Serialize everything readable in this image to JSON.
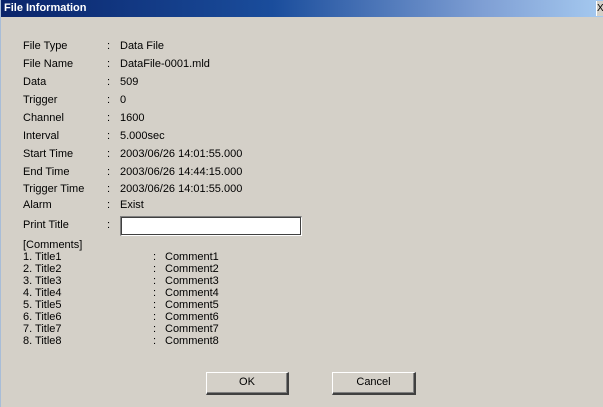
{
  "window": {
    "title": "File Information",
    "close_glyph": "X"
  },
  "fields": [
    {
      "label": "File Type",
      "colon": ":",
      "value": "Data File"
    },
    {
      "label": "File Name",
      "colon": ":",
      "value": "DataFile-0001.mld"
    },
    {
      "label": "Data",
      "colon": ":",
      "value": "509"
    },
    {
      "label": "Trigger",
      "colon": ":",
      "value": "0"
    },
    {
      "label": "Channel",
      "colon": ":",
      "value": "1600"
    },
    {
      "label": "Interval",
      "colon": ":",
      "value": "5.000sec"
    },
    {
      "label": "Start Time",
      "colon": ":",
      "value": "2003/06/26 14:01:55.000"
    },
    {
      "label": "End Time",
      "colon": ":",
      "value": "2003/06/26 14:44:15.000"
    },
    {
      "label": "Trigger Time",
      "colon": ":",
      "value": "2003/06/26 14:01:55.000"
    },
    {
      "label": "Alarm",
      "colon": ":",
      "value": "Exist"
    }
  ],
  "print_title": {
    "label": "Print Title",
    "colon": ":",
    "value": ""
  },
  "comments": {
    "header": "[Comments]",
    "items": [
      {
        "title": "1.  Title1",
        "colon": ":",
        "comment": "Comment1"
      },
      {
        "title": "2.  Title2",
        "colon": ":",
        "comment": "Comment2"
      },
      {
        "title": "3.  Title3",
        "colon": ":",
        "comment": "Comment3"
      },
      {
        "title": "4.  Title4",
        "colon": ":",
        "comment": "Comment4"
      },
      {
        "title": "5.  Title5",
        "colon": ":",
        "comment": "Comment5"
      },
      {
        "title": "6.  Title6",
        "colon": ":",
        "comment": "Comment6"
      },
      {
        "title": "7.  Title7",
        "colon": ":",
        "comment": "Comment7"
      },
      {
        "title": "8.  Title8",
        "colon": ":",
        "comment": "Comment8"
      }
    ]
  },
  "buttons": {
    "ok_label": "OK",
    "cancel_label": "Cancel"
  }
}
